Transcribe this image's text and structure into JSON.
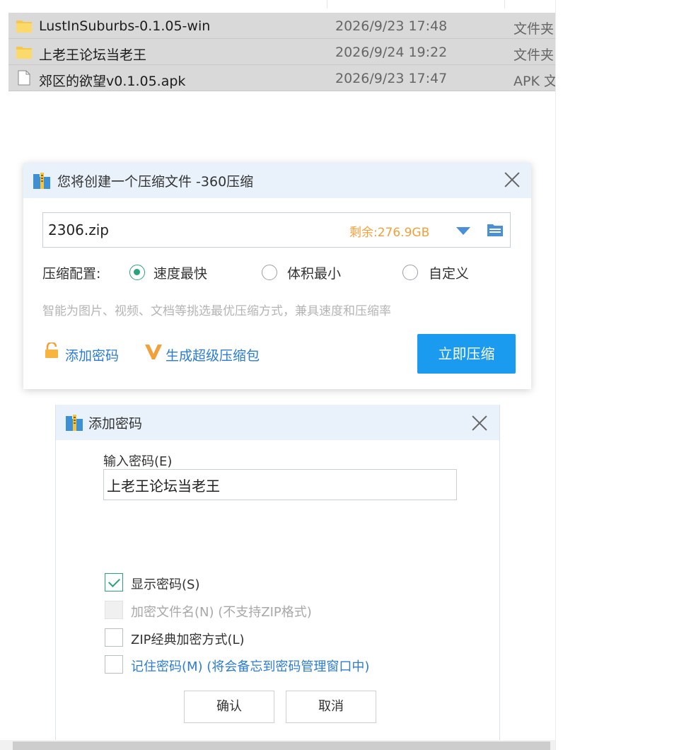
{
  "files": [
    {
      "name": "LustInSuburbs-0.1.05-win",
      "date": "2026/9/23 17:48",
      "type": "文件夹",
      "icon": "folder-icon"
    },
    {
      "name": "上老王论坛当老王",
      "date": "2026/9/24 19:22",
      "type": "文件夹",
      "icon": "folder-icon"
    },
    {
      "name": "郊区的欲望v0.1.05.apk",
      "date": "2026/9/23 17:47",
      "type": "APK 文",
      "icon": "file-icon"
    }
  ],
  "compress_dialog": {
    "title": "您将创建一个压缩文件 -360压缩",
    "path": "2306.zip",
    "free_space": "剩余:276.9GB",
    "config_label": "压缩配置:",
    "options": [
      "速度最快",
      "体积最小",
      "自定义"
    ],
    "selected_option": "速度最快",
    "hint": "智能为图片、视频、文档等挑选最优压缩方式，兼具速度和压缩率",
    "add_password": "添加密码",
    "super_pack": "生成超级压缩包",
    "compress_button": "立即压缩"
  },
  "password_dialog": {
    "title": "添加密码",
    "input_label": "输入密码(E)",
    "password_value": "上老王论坛当老王",
    "checkboxes": [
      {
        "label": "显示密码(S)",
        "checked": true,
        "enabled": true
      },
      {
        "label": "加密文件名(N) (不支持ZIP格式)",
        "checked": false,
        "enabled": false
      },
      {
        "label": "ZIP经典加密方式(L)",
        "checked": false,
        "enabled": true
      },
      {
        "label": "记住密码(M) (将会备忘到密码管理窗口中)",
        "checked": false,
        "enabled": true
      }
    ],
    "ok_button": "确认",
    "cancel_button": "取消"
  },
  "colors": {
    "accent": "#1a9bf0",
    "link": "#2b7cd3",
    "radio_checked": "#2aa37a",
    "free_space": "#f2a03a",
    "title_bar": "#e9f2fb"
  }
}
